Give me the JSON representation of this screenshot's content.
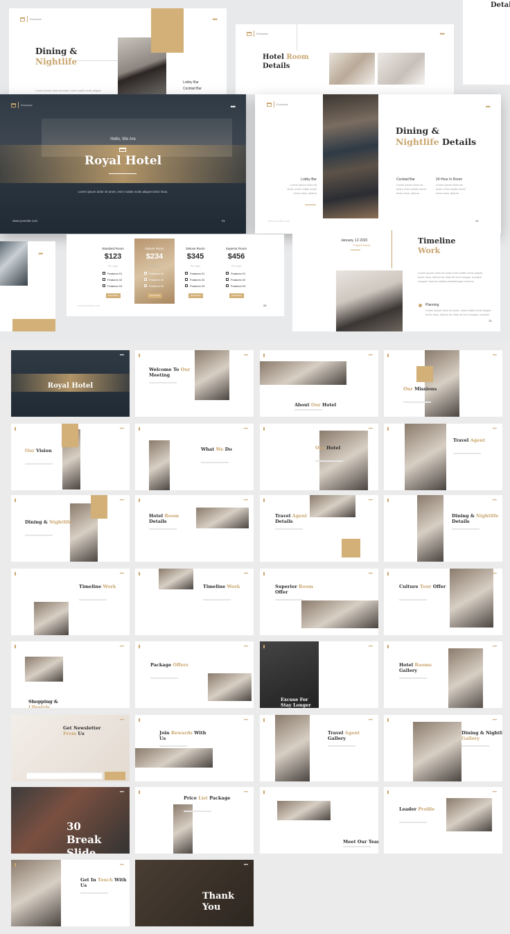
{
  "colors": {
    "accent": "#c9a56e",
    "dark": "#2a2a2a",
    "background": "#ebebeb"
  },
  "brand": {
    "line1": "Exclusive",
    "line2": "Hotel",
    "crown": "Royal"
  },
  "menu_icon": "more-dots-icon",
  "website": "www.yoursite.com",
  "lorem_short": "Lorem ipsum dolor sit amet, enim mattis motis aliquet",
  "lorem_col": "Lorem ipsum dolor sit amet, enim mattis morbi tortor risus, dictum",
  "dining": {
    "title1": "Dining &",
    "title2": "Nightlife",
    "items": [
      "Lobby Bar",
      "Cocktail Bar"
    ]
  },
  "room_details": {
    "title1": "Hotel",
    "title2": "Room",
    "title3": "Details"
  },
  "partial_title": "Detai",
  "hero": {
    "greeting": "Hello, We Are",
    "title": "Royal Hotel",
    "subtitle": "Lorem ipsum dolor sit amet, enim mattis motis aliquet tortor risus.",
    "page": "01"
  },
  "dining_details": {
    "title1": "Dining &",
    "title2": "Nightlife",
    "title3": "Details",
    "cols": [
      {
        "title": "Lobby Bar"
      },
      {
        "title": "Cocktail Bar"
      },
      {
        "title": "24 Hour In Room"
      }
    ],
    "page": "12"
  },
  "pricing": {
    "plans": [
      {
        "name": "Standard Room",
        "price": "$123"
      },
      {
        "name": "Deluxe Room",
        "price": "$234"
      },
      {
        "name": "Deluxe Room",
        "price": "$345"
      },
      {
        "name": "Superior Room",
        "price": "$456"
      }
    ],
    "per_night": "Per night",
    "features": [
      "Features 01",
      "Features 02",
      "Features 03"
    ],
    "button": "Read More",
    "page": "26"
  },
  "timeline": {
    "date": "January, 12 2020",
    "date_sub": "Project Name",
    "title1": "Timeline",
    "title2": "Work",
    "text": "Lorem ipsum dolor sit amet enim mattis motis aliquet tortor risus, dictum de vitae sit cum congue, suscipit congue rhoncus nullam pellentesque rhoncus",
    "item": "Planning",
    "item_text": "Lorem ipsum dolor sit amet, enim mattis motis aliquet tortor risus, dictum de vitae sit cum congue, suscipit",
    "page": "13"
  },
  "thumbnails": [
    {
      "a": "Royal Hotel",
      "b": "",
      "c": ""
    },
    {
      "a": "Welcome To ",
      "b": "Our",
      "c": " Meeting"
    },
    {
      "a": "About ",
      "b": "Our",
      "c": " Hotel"
    },
    {
      "a": "",
      "b": "Our",
      "c": " Missions"
    },
    {
      "a": "",
      "b": "Our",
      "c": " Vision"
    },
    {
      "a": "What ",
      "b": "We",
      "c": " Do"
    },
    {
      "a": "",
      "b": "Our",
      "c": " Hotel"
    },
    {
      "a": "Travel ",
      "b": "Agent",
      "c": ""
    },
    {
      "a": "Dining & ",
      "b": "Nightlife",
      "c": ""
    },
    {
      "a": "Hotel ",
      "b": "Room",
      "c": " Details"
    },
    {
      "a": "Travel ",
      "b": "Agent",
      "c": " Details"
    },
    {
      "a": "Dining & ",
      "b": "Nightlife",
      "c": " Details"
    },
    {
      "a": "Timeline ",
      "b": "Work",
      "c": ""
    },
    {
      "a": "Timeline ",
      "b": "Work",
      "c": ""
    },
    {
      "a": "Superior ",
      "b": "Room",
      "c": " Offer"
    },
    {
      "a": "Culture ",
      "b": "Tour",
      "c": " Offer"
    },
    {
      "a": "Shopping & ",
      "b": "Lifestyle",
      "c": ""
    },
    {
      "a": "Package ",
      "b": "Offers",
      "c": ""
    },
    {
      "a": "Excuse For Stay Longer",
      "b": "",
      "c": ""
    },
    {
      "a": "Hotel ",
      "b": "Rooms",
      "c": " Gallery"
    },
    {
      "a": "Get Newsletter ",
      "b": "From",
      "c": " Us"
    },
    {
      "a": "Join ",
      "b": "Rewards",
      "c": " With Us"
    },
    {
      "a": "Travel ",
      "b": "Agent",
      "c": " Gallery"
    },
    {
      "a": "Dining & Nightlife ",
      "b": "Gallery",
      "c": ""
    },
    {
      "a": "30 Break Slide",
      "b": "",
      "c": ""
    },
    {
      "a": "Price ",
      "b": "List",
      "c": " Package"
    },
    {
      "a": "Meet Our Team",
      "b": "",
      "c": ""
    },
    {
      "a": "Leader ",
      "b": "Profile",
      "c": ""
    },
    {
      "a": "Get In ",
      "b": "Touch",
      "c": " With Us"
    },
    {
      "a": "Thank You",
      "b": "",
      "c": ""
    }
  ]
}
